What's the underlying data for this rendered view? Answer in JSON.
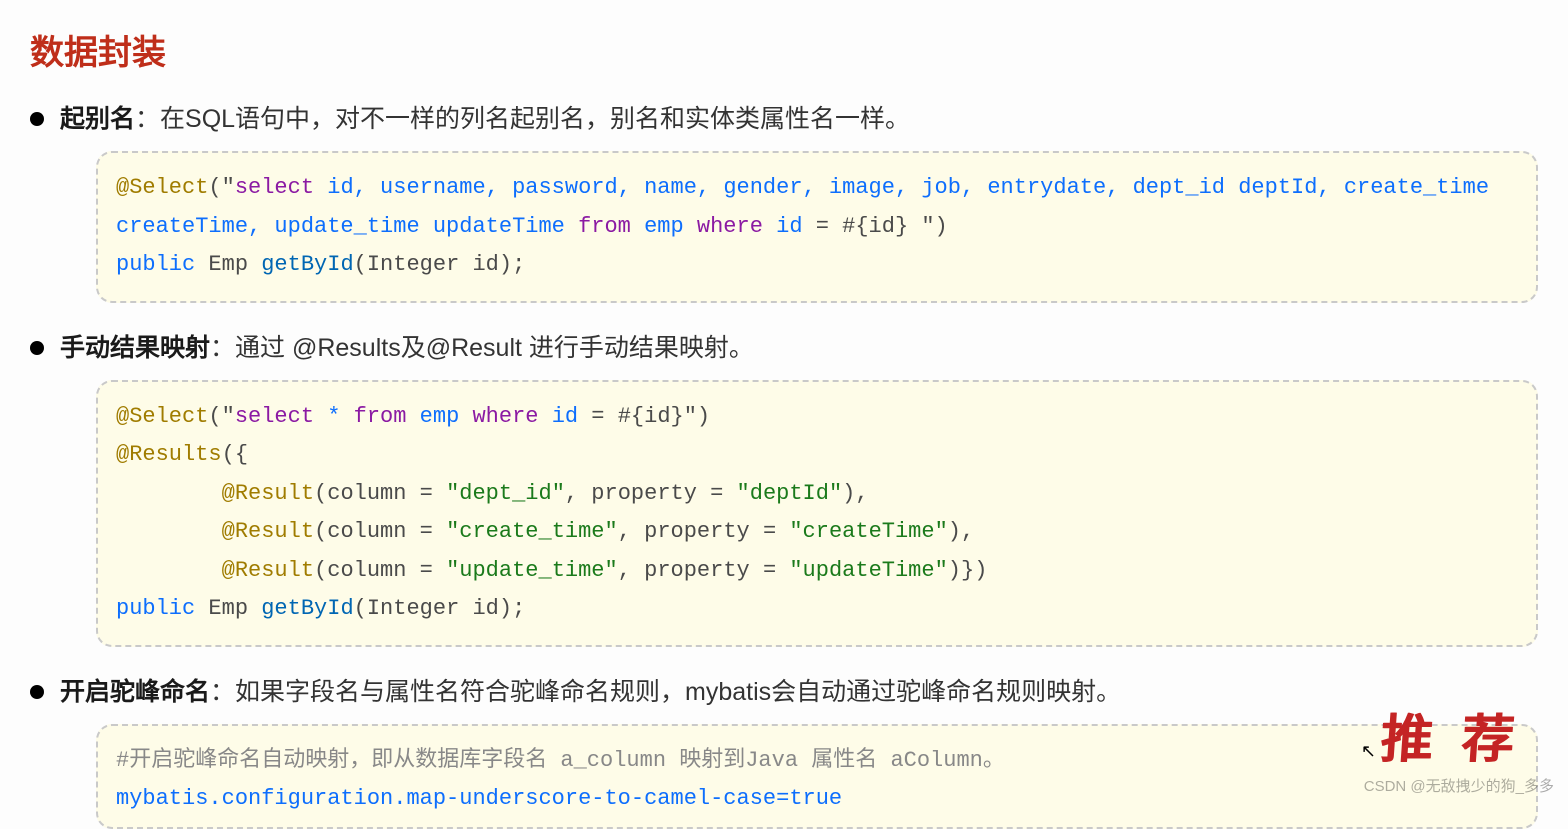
{
  "title": "数据封装",
  "item1": {
    "label": "起别名",
    "desc": "：在SQL语句中，对不一样的列名起别名，别名和实体类属性名一样。",
    "code": {
      "ann": "@Select",
      "str_open": "(\"",
      "kw_select": "select",
      "fields": " id, username, password, name, gender, image, job, entrydate, dept_id deptId, create_time createTime, update_time updateTime ",
      "kw_from": "from",
      "tbl": " emp ",
      "kw_where": "where",
      "cond": " id",
      "eq": " = #{id} \")",
      "pub": "public",
      "type": " Emp ",
      "method": "getById",
      "params": "(Integer id);"
    }
  },
  "item2": {
    "label": "手动结果映射",
    "desc": "：通过 @Results及@Result 进行手动结果映射。",
    "code": {
      "ann_select": "@Select",
      "str1a": "(\"",
      "kw_select": "select",
      "star": " * ",
      "kw_from": "from",
      "tbl": " emp ",
      "kw_where": "where",
      "cond": " id",
      "eq": " = #{id}\")",
      "ann_results": "@Results",
      "open": "({",
      "ann_r": "@Result",
      "r1_col": "(column = ",
      "r1_cv": "\"dept_id\"",
      "r1_prop": ", property = ",
      "r1_pv": "\"deptId\"",
      "r1_end": "),",
      "r2_cv": "\"create_time\"",
      "r2_pv": "\"createTime\"",
      "r3_cv": "\"update_time\"",
      "r3_pv": "\"updateTime\"",
      "r3_end": ")})",
      "pub": "public",
      "type": " Emp ",
      "method": "getById",
      "params": "(Integer id);"
    }
  },
  "item3": {
    "label": "开启驼峰命名",
    "desc": "：如果字段名与属性名符合驼峰命名规则，mybatis会自动通过驼峰命名规则映射。",
    "code": {
      "cmt": "#开启驼峰命名自动映射，即从数据库字段名 a_column 映射到Java 属性名 aColumn。",
      "cfg": "mybatis.configuration.map-underscore-to-camel-case=",
      "val": "true"
    }
  },
  "stamp": "推 荐",
  "watermark": "CSDN @无敌拽少的狗_多多"
}
